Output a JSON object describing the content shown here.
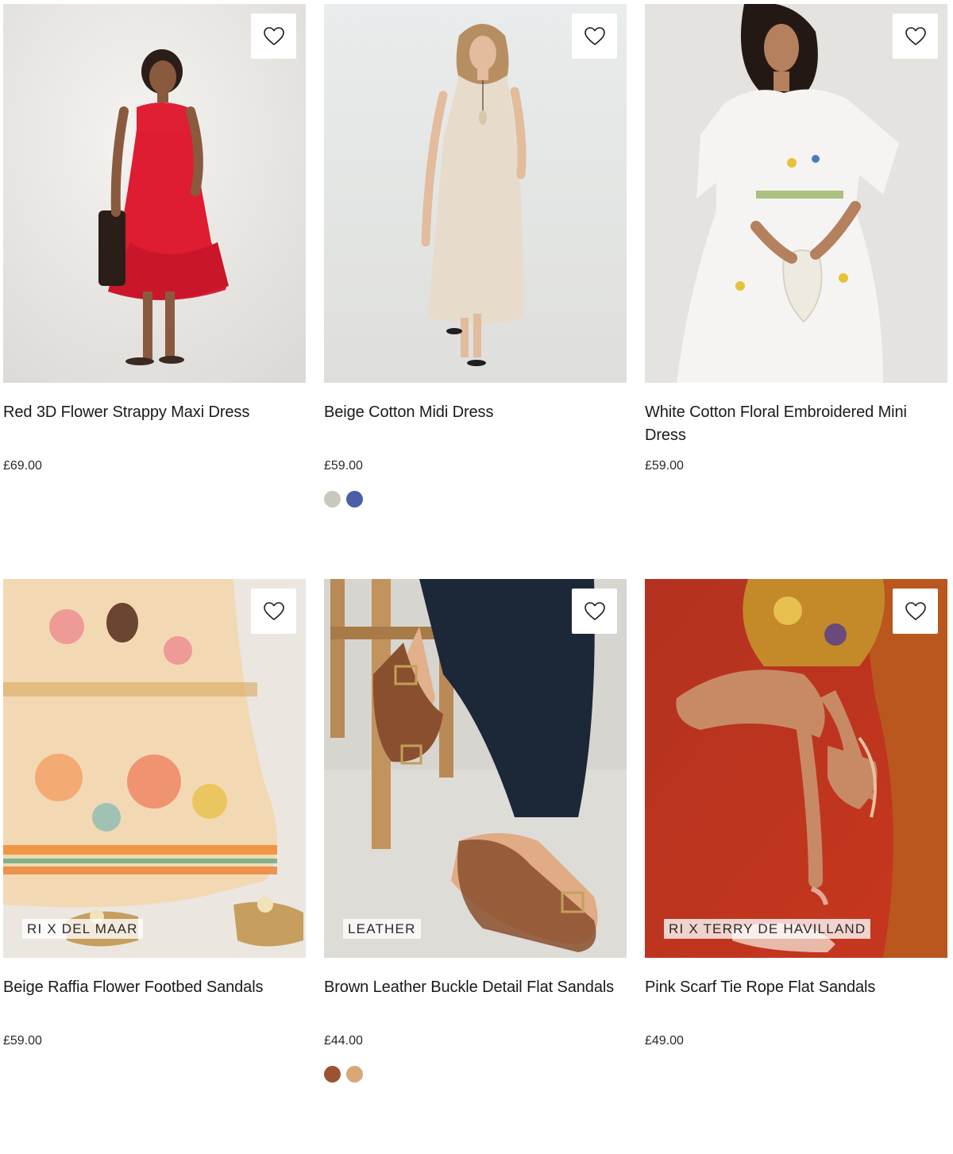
{
  "products": [
    {
      "title": "Red 3D Flower Strappy Maxi Dress",
      "price": "£69.00",
      "badge": "",
      "wishlist_icon": "heart-icon",
      "swatches": []
    },
    {
      "title": "Beige Cotton Midi Dress",
      "price": "£59.00",
      "badge": "",
      "wishlist_icon": "heart-icon",
      "swatches": [
        "#c9c8be",
        "#4b5ea8"
      ]
    },
    {
      "title": "White Cotton Floral Embroidered Mini Dress",
      "price": "£59.00",
      "badge": "",
      "wishlist_icon": "heart-icon",
      "swatches": []
    },
    {
      "title": "Beige Raffia Flower Footbed Sandals",
      "price": "£59.00",
      "badge": "RI X DEL MAAR",
      "wishlist_icon": "heart-icon",
      "swatches": []
    },
    {
      "title": "Brown Leather Buckle Detail Flat Sandals",
      "price": "£44.00",
      "badge": "LEATHER",
      "wishlist_icon": "heart-icon",
      "swatches": [
        "#9a5432",
        "#d9a877"
      ]
    },
    {
      "title": "Pink Scarf Tie Rope Flat Sandals",
      "price": "£49.00",
      "badge": "RI X TERRY DE HAVILLAND",
      "wishlist_icon": "heart-icon",
      "swatches": []
    }
  ]
}
